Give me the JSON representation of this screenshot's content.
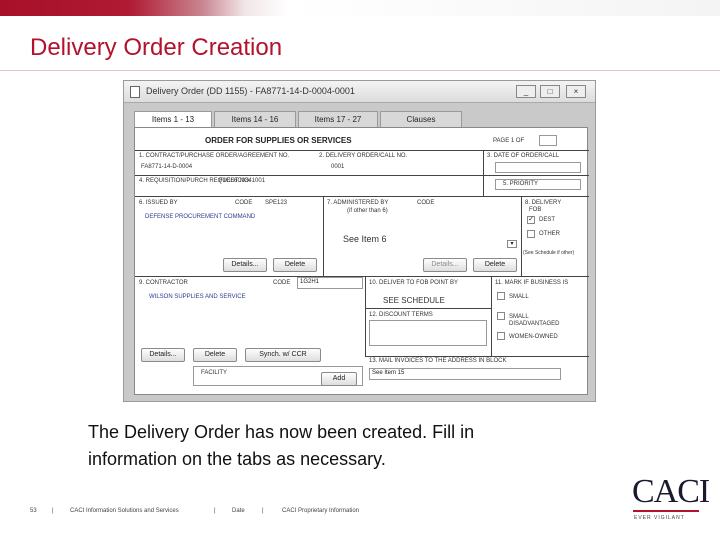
{
  "slide": {
    "title": "Delivery Order Creation",
    "caption_line1": "The Delivery Order has now been created.  Fill in",
    "caption_line2": "information on the tabs as necessary."
  },
  "window": {
    "title": "Delivery Order (DD 1155) - FA8771-14-D-0004-0001",
    "minimize": "_",
    "maximize": "□",
    "close": "×"
  },
  "tabs": [
    {
      "label": "Items 1 - 13",
      "active": true
    },
    {
      "label": "Items 14 - 16",
      "active": false
    },
    {
      "label": "Items 17 - 27",
      "active": false
    },
    {
      "label": "Clauses",
      "active": false
    }
  ],
  "form": {
    "heading": "ORDER FOR SUPPLIES OR SERVICES",
    "page_label": "PAGE 1 OF",
    "f1_label": "1. CONTRACT/PURCHASE ORDER/AGREEMENT NO.",
    "f1_value": "FA8771-14-D-0004",
    "f2_label": "2. DELIVERY ORDER/CALL NO.",
    "f2_value": "0001",
    "f3_label": "3. DATE OF ORDER/CALL",
    "f4_label": "4. REQUISITION/PURCH REQUEST NO.",
    "f4_value": "F1GL6C0341001",
    "f5_label": "5. PRIORITY",
    "f6_label": "6. ISSUED BY",
    "f6_code_label": "CODE",
    "f6_code": "SPE123",
    "f6_name": "DEFENSE PROCUREMENT COMMAND",
    "f7_label": "7. ADMINISTERED BY",
    "f7_sub": "(if other than 6)",
    "f7_code_label": "CODE",
    "f7_value": "See Item 6",
    "f8_label": "8. DELIVERY",
    "f8_sub": "FOB",
    "dest_label": "DEST",
    "other_label": "OTHER",
    "schedule_note": "(See Schedule if other)",
    "details_label": "Details...",
    "delete_label": "Delete",
    "f9_label": "9. CONTRACTOR",
    "f9_code_label": "CODE",
    "f9_code": "1G2H1",
    "f9_name": "WILSON SUPPLIES AND SERVICE",
    "facility_label": "FACILITY",
    "add_label": "Add",
    "sync_label": "Synch. w/ CCR",
    "f10_label": "10. DELIVER TO FOB POINT BY",
    "f10_value": "SEE SCHEDULE",
    "f11_label": "11. MARK IF BUSINESS IS",
    "small_label": "SMALL",
    "small_disadv_label": "SMALL DISADVANTAGED",
    "women_owned_label": "WOMEN-OWNED",
    "f12_label": "12. DISCOUNT TERMS",
    "f13_label": "13. MAIL INVOICES TO THE ADDRESS IN BLOCK",
    "f13_value": "See Item 15"
  },
  "footer": {
    "page_num": "53",
    "sep": "|",
    "company": "CACI Information Solutions and Services",
    "date": "Date",
    "proprietary": "CACI Proprietary Information"
  },
  "logo": {
    "text": "CACI",
    "tagline": "EVER VIGILANT"
  },
  "colors": {
    "brand_red": "#b3122d"
  }
}
